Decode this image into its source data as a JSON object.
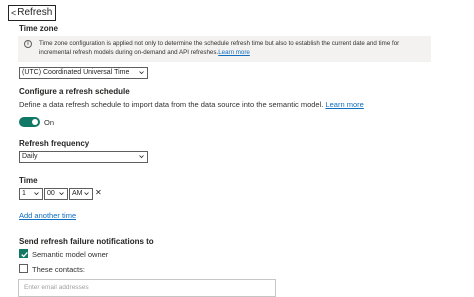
{
  "header": {
    "title": "Refresh",
    "caret": "<"
  },
  "timezone": {
    "label": "Time zone",
    "info_text": "Time zone configuration is applied not only to determine the schedule refresh time but also to establish the current date and time for incremental refresh models during on-demand and API refreshes.",
    "info_link": "Learn more",
    "selected": "(UTC) Coordinated Universal Time"
  },
  "schedule": {
    "label": "Configure a refresh schedule",
    "description": "Define a data refresh schedule to import data from the data source into the semantic model.",
    "description_link": "Learn more",
    "toggle_label": "On",
    "toggle_on": true
  },
  "frequency": {
    "label": "Refresh frequency",
    "selected": "Daily"
  },
  "time": {
    "label": "Time",
    "hour": "1",
    "minute": "00",
    "ampm": "AM",
    "remove_glyph": "✕",
    "add_link": "Add another time"
  },
  "notifications": {
    "label": "Send refresh failure notifications to",
    "owner_label": "Semantic model owner",
    "owner_checked": true,
    "contacts_label": "These contacts:",
    "contacts_checked": false,
    "email_placeholder": "Enter email addresses"
  },
  "colors": {
    "accent": "#117865",
    "link": "#106ebe"
  }
}
